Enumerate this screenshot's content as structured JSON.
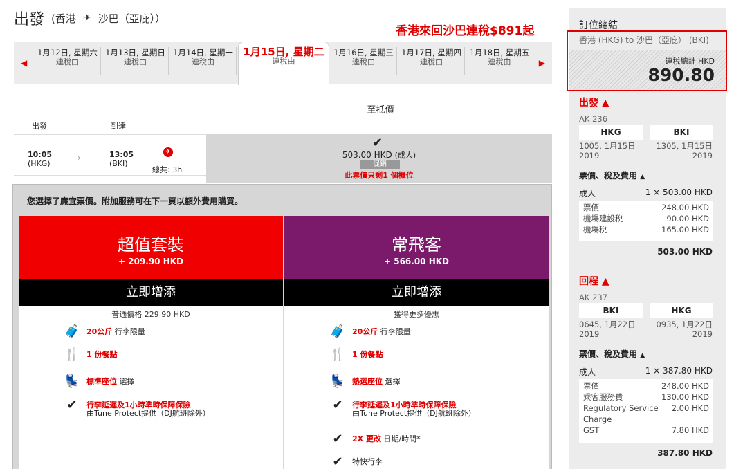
{
  "header": {
    "title": "出發",
    "from": "(香港",
    "to": "沙巴（亞庇））"
  },
  "promo": "香港來回沙巴連稅$891起",
  "dates": [
    {
      "d": "1月12日, 星期六",
      "s": "連稅由"
    },
    {
      "d": "1月13日, 星期日",
      "s": "連稅由"
    },
    {
      "d": "1月14日, 星期一",
      "s": "連稅由"
    },
    {
      "d": "1月15日, 星期二",
      "s": "連稅由"
    },
    {
      "d": "1月16日, 星期三",
      "s": "連稅由"
    },
    {
      "d": "1月17日, 星期四",
      "s": "連稅由"
    },
    {
      "d": "1月18日, 星期五",
      "s": "連稅由"
    }
  ],
  "fare_col": "至抵價",
  "labels": {
    "depart": "出發",
    "arrive": "到達"
  },
  "flight": {
    "dep_time": "10:05",
    "dep_code": "(HKG)",
    "arr_time": "13:05",
    "arr_code": "(BKI)",
    "duration": "總共: 3h"
  },
  "fare": {
    "price": "503.00 HKD",
    "unit": "(成人)",
    "tag": "促銷",
    "seats": "此票價只剩1 個機位"
  },
  "note": "您選擇了廉宜票價。附加服務可在下一頁以額外費用購買。",
  "cards": [
    {
      "name": "超值套裝",
      "price": "+ 209.90 HKD",
      "add": "立即增添",
      "sub": "普通價格 229.90 HKD",
      "color": "#f00000",
      "features": [
        {
          "red": "20公斤",
          "text": " 行李限量"
        },
        {
          "red": "1 份餐點",
          "text": ""
        },
        {
          "red": "標準座位",
          "text": " 選擇"
        },
        {
          "red": "行李延遲及1小時準時保障保險",
          "text": "由Tune Protect提供（DJ航班除外）"
        }
      ]
    },
    {
      "name": "常飛客",
      "price": "+ 566.00 HKD",
      "add": "立即增添",
      "sub": "獲得更多優惠",
      "color": "#7b1a6a",
      "features": [
        {
          "red": "20公斤",
          "text": " 行李限量"
        },
        {
          "red": "1 份餐點",
          "text": ""
        },
        {
          "red": "熱選座位",
          "text": " 選擇"
        },
        {
          "red": "行李延遲及1小時準時保障保險",
          "text": "由Tune Protect提供（DJ航班除外）"
        },
        {
          "red": "2X 更改",
          "text": " 日期/時間*"
        },
        {
          "red": "",
          "text": "特快行李"
        }
      ]
    }
  ],
  "sidebar": {
    "title": "訂位總結",
    "route": "香港 (HKG) to 沙巴（亞庇） (BKI)",
    "total_label": "連稅總計 HKD",
    "total": "890.80",
    "out": {
      "label": "出發",
      "flight": "AK 236",
      "from": "HKG",
      "to": "BKI",
      "dep": "1005, 1月15日",
      "dep_y": "2019",
      "arr": "1305, 1月15日",
      "arr_y": "2019",
      "fees_title": "票價、稅及費用",
      "adult": "成人",
      "adult_v": "1 × 503.00 HKD",
      "items": [
        [
          "票價",
          "248.00 HKD"
        ],
        [
          "機場建設稅",
          "90.00 HKD"
        ],
        [
          "機場稅",
          "165.00 HKD"
        ]
      ],
      "subtotal": "503.00 HKD"
    },
    "ret": {
      "label": "回程",
      "flight": "AK 237",
      "from": "BKI",
      "to": "HKG",
      "dep": "0645, 1月22日",
      "dep_y": "2019",
      "arr": "0935, 1月22日",
      "arr_y": "2019",
      "fees_title": "票價、稅及費用",
      "adult": "成人",
      "adult_v": "1 × 387.80 HKD",
      "items": [
        [
          "票價",
          "248.00 HKD"
        ],
        [
          "乘客服務費",
          "130.00 HKD"
        ],
        [
          "Regulatory Service Charge",
          "2.00 HKD"
        ],
        [
          "GST",
          "7.80 HKD"
        ]
      ],
      "subtotal": "387.80 HKD"
    }
  }
}
